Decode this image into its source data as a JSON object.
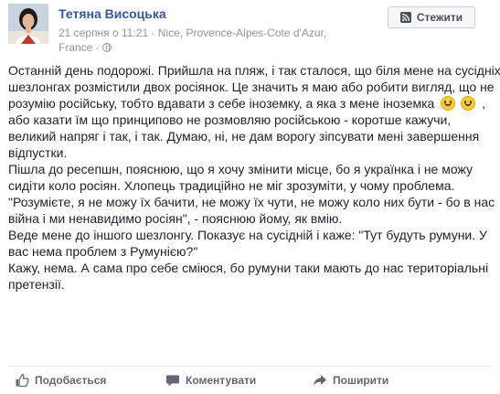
{
  "post": {
    "author": "Тетяна Висоцька",
    "meta_line1": "21 серпня о 11:21 · Nice, Provence-Alpes-Cote d'Azur,",
    "meta_line2": "France ·",
    "privacy_icon": "globe-icon",
    "follow_label": "Стежити",
    "follow_icon": "rss-icon",
    "paragraphs": [
      {
        "before": "Останній день подорожі. Прийшла на пляж, і так сталося, що біля мене на сусідніх шезлонгах розмістили двох росіянок. Це значить я маю або робити вигляд, що не розумію російську, тобто вдавати з себе іноземку, а яка з мене іноземка",
        "after": ", або казати їм що принципово не розмовляю російською - коротше кажучи, великий напряг і так, і так. Думаю, ні, не дам ворогу зіпсувати мені завершення відпустки."
      },
      "Пішла до ресепшн, пояснюю, що я хочу змінити місце, бо я українка і не можу сидіти коло росіян. Хлопець традиційно не міг зрозуміти, у чому проблема.",
      "\"Розумієте, я не можу їх бачити, не можу їх чути, не можу коло них бути - бо в нас війна і ми ненавидимо росіян\", - пояснюю йому, як вмію.",
      "Веде мене до іншого шезлонгу. Показує на сусідній і каже: \"Тут будуть румуни. У вас нема проблем з Румунією?\"",
      "Кажу, нема. А сама про себе сміюся, бо румуни таки мають до нас територіальні претензії."
    ],
    "emoji_icon": "smile-emoji-icon"
  },
  "actions": {
    "like_label": "Подобається",
    "comment_label": "Коментувати",
    "share_label": "Поширити"
  },
  "colors": {
    "author_link": "#365899",
    "meta_gray": "#90949c",
    "text": "#1d2129",
    "action_gray": "#616770"
  }
}
